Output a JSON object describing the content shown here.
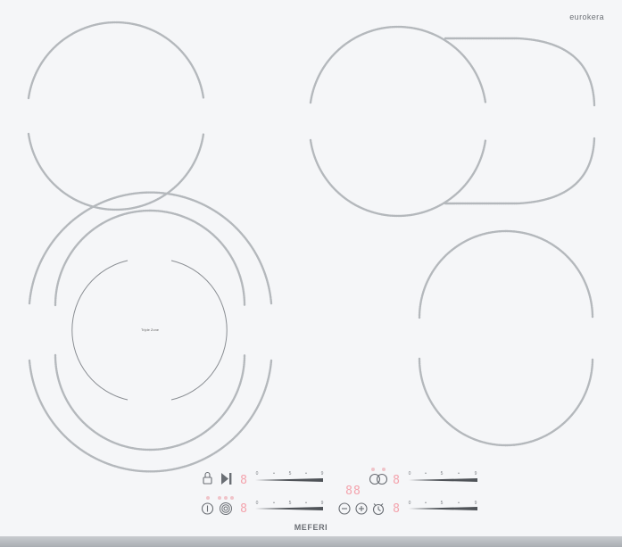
{
  "brand": {
    "top_logo": "eurokera",
    "bottom_logo": "MEFERI"
  },
  "zones": {
    "front_left_label": "Triple Zone"
  },
  "sliders": {
    "top_left": {
      "ticks": [
        "0",
        "•",
        "5",
        "•",
        "9"
      ],
      "level": 0.6
    },
    "bottom_left": {
      "ticks": [
        "0",
        "•",
        "5",
        "•",
        "9"
      ],
      "level": 0.6
    },
    "top_right": {
      "ticks": [
        "0",
        "•",
        "5",
        "•",
        "9"
      ],
      "level": 0.6
    },
    "bottom_right": {
      "ticks": [
        "0",
        "•",
        "5",
        "•",
        "9"
      ],
      "level": 0.6
    }
  },
  "displays": {
    "top_left": "8",
    "bottom_left": "8",
    "top_right": "8",
    "bottom_right": "8",
    "timer": "88"
  },
  "icons": {
    "lock": "lock-icon",
    "play_pause": "play-pause-icon",
    "power": "power-icon",
    "triple_zone": "triple-zone-icon",
    "minus": "minus-icon",
    "plus": "plus-icon",
    "timer": "timer-icon",
    "dual_zone": "dual-zone-icon"
  },
  "colors": {
    "glass": "#f5f6f8",
    "zone_ring": "#b4b8bc",
    "print": "#6a6e74",
    "display": "#f4a3ad"
  }
}
